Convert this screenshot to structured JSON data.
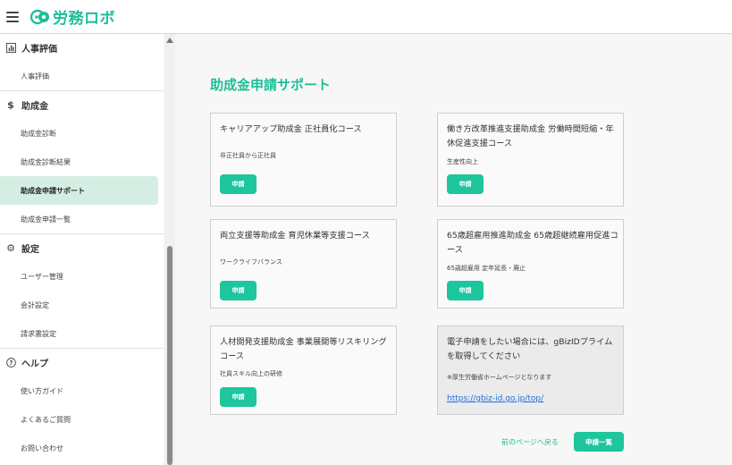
{
  "header": {
    "logo_text": "労務ロボ"
  },
  "sidebar": {
    "sections": [
      {
        "label": "人事評価",
        "icon": "chart-icon",
        "items": [
          "人事評価"
        ]
      },
      {
        "label": "助成金",
        "icon": "dollar-icon",
        "items": [
          "助成金診断",
          "助成金診断結果",
          "助成金申請サポート",
          "助成金申請一覧"
        ]
      },
      {
        "label": "設定",
        "icon": "gear-icon",
        "items": [
          "ユーザー管理",
          "会計設定",
          "請求書設定"
        ]
      },
      {
        "label": "ヘルプ",
        "icon": "help-circle-icon",
        "items": [
          "使い方ガイド",
          "よくあるご質問",
          "お問い合わせ"
        ]
      }
    ],
    "active_item": "助成金申請サポート"
  },
  "main": {
    "title": "助成金申請サポート",
    "cards": [
      {
        "title": "キャリアアップ助成金 正社員化コース",
        "subtitle": "非正社員から正社員",
        "button": "申請"
      },
      {
        "title": "働き方改革推進支援助成金 労働時間短縮・年休促進支援コース",
        "subtitle": "生産性向上",
        "button": "申請"
      },
      {
        "title": "両立支援等助成金 育児休業等支援コース",
        "subtitle": "ワークライフバランス",
        "button": "申請"
      },
      {
        "title": "65歳超雇用推進助成金 65歳超継続雇用促進コース",
        "subtitle": "65歳超雇用 定年延長・廃止",
        "button": "申請"
      },
      {
        "title": "人材開発支援助成金 事業展開等リスキリングコース",
        "subtitle": "社員スキル向上の研修",
        "button": "申請"
      }
    ],
    "gbiz": {
      "title": "電子申請をしたい場合には、gBizIDプライムを取得してください",
      "note": "※厚生労働省ホームページとなります",
      "link": "https://gbiz-id.go.jp/top/"
    },
    "back_link": "前のページへ戻る",
    "list_button": "申請一覧"
  },
  "colors": {
    "accent": "#1dc69c",
    "active_bg": "#d5eee3",
    "link": "#1f6fd6"
  }
}
